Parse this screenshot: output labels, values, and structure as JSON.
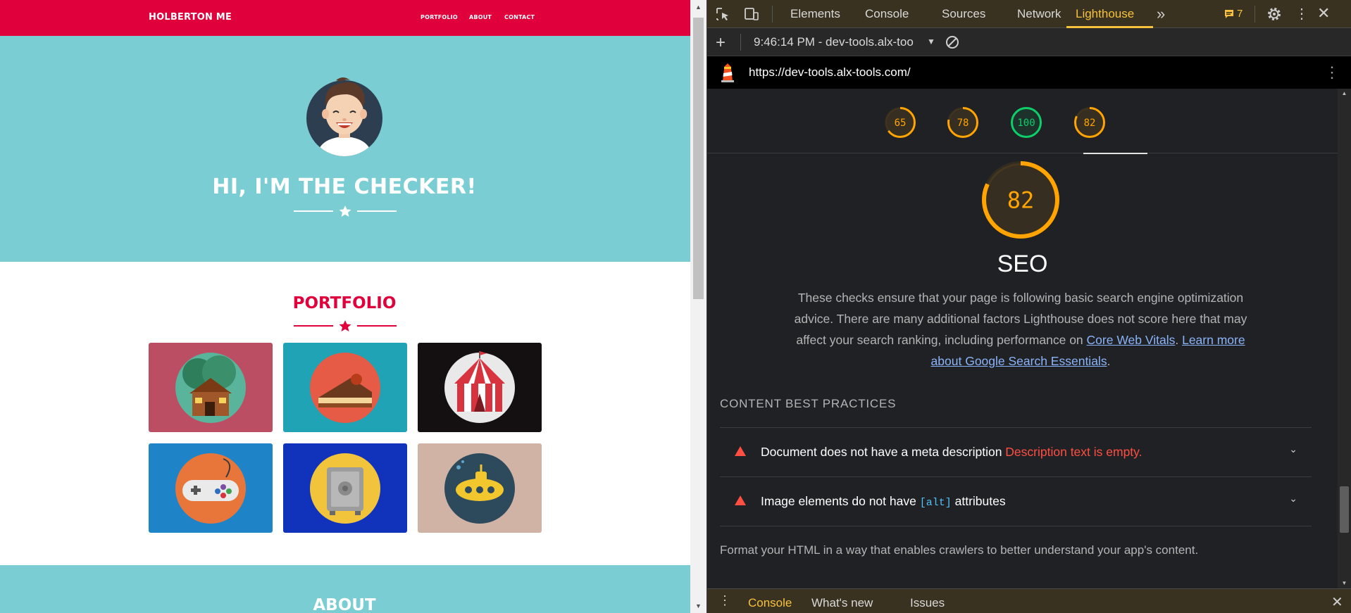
{
  "site": {
    "brand": "HOLBERTON ME",
    "nav": [
      "PORTFOLIO",
      "ABOUT",
      "CONTACT"
    ],
    "hero_title": "HI, I'M THE CHECKER!",
    "portfolio_title": "PORTFOLIO",
    "about_title": "ABOUT",
    "colors": {
      "nav": "#e0003c",
      "hero": "#79cdd3",
      "accent": "#e0003c"
    },
    "tiles": [
      {
        "name": "cabin",
        "bg": "#bc4e64"
      },
      {
        "name": "cake",
        "bg": "#1fa3b5"
      },
      {
        "name": "circus",
        "bg": "#141011"
      },
      {
        "name": "game-controller",
        "bg": "#1f84c7"
      },
      {
        "name": "safe",
        "bg": "#1133bb"
      },
      {
        "name": "submarine",
        "bg": "#d0b3a4"
      }
    ]
  },
  "devtools": {
    "tabs": [
      "Elements",
      "Console",
      "Sources",
      "Network",
      "Lighthouse"
    ],
    "active_tab": "Lighthouse",
    "issues_count": "7",
    "report_selector": "9:46:14 PM - dev-tools.alx-too",
    "url": "https://dev-tools.alx-tools.com/",
    "scores": [
      {
        "value": 65,
        "color": "#ffa400"
      },
      {
        "value": 78,
        "color": "#ffa400"
      },
      {
        "value": 100,
        "color": "#0cce6b"
      },
      {
        "value": 82,
        "color": "#ffa400"
      }
    ],
    "category": {
      "score": 82,
      "title": "SEO",
      "description": "These checks ensure that your page is following basic search engine optimization advice. There are many additional factors Lighthouse does not score here that may affect your search ranking, including performance on",
      "link1": "Core Web Vitals",
      "separator": ". ",
      "link2": "Learn more about Google Search Essentials",
      "end": "."
    },
    "group_title": "CONTENT BEST PRACTICES",
    "audits": [
      {
        "title": "Document does not have a meta description",
        "detail": "Description text is empty."
      },
      {
        "title_before": "Image elements do not have",
        "code": "[alt]",
        "title_after": "attributes"
      }
    ],
    "group_description": "Format your HTML in a way that enables crawlers to better understand your app's content.",
    "drawer_tabs": [
      "Console",
      "What's new",
      "Issues"
    ]
  }
}
